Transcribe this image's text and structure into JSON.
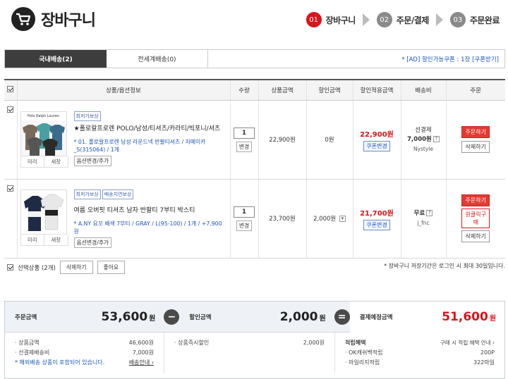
{
  "header": {
    "title": "장바구니"
  },
  "steps": [
    {
      "num": "01",
      "label": "장바구니",
      "active": true
    },
    {
      "num": "02",
      "label": "주문/결제",
      "active": false
    },
    {
      "num": "03",
      "label": "주문완료",
      "active": false
    }
  ],
  "tabs": [
    {
      "label": "국내배송(2)",
      "active": true
    },
    {
      "label": "전세계배송(0)",
      "active": false
    }
  ],
  "coupon_notice": "* [AD] 할인가능쿠폰 : 1장 [쿠폰받기]",
  "table": {
    "headers": [
      "상품/옵션정보",
      "수량",
      "상품금액",
      "할인금액",
      "할인적용금액",
      "배송비",
      "주문"
    ],
    "rows": [
      {
        "badges": [
          "최저가보상"
        ],
        "name": "★폴로랄프로렌 POLO/남성/티셔츠/카라티/빅포니/셔츠",
        "option": "* 01. 폴로랄프로렌 남성 라운드넥 반팔티셔츠 / 자메이카_S(315064) / 1개",
        "option_btn": "옵션변경/추가",
        "thumb_labels": [
          "미리",
          "새창"
        ],
        "qty": "1",
        "qty_btn": "변경",
        "price": "22,900원",
        "discount": "0원",
        "final_price": "22,900원",
        "coupon_btn": "쿠폰변경",
        "ship_type": "선결제",
        "ship_fee": "7,000원",
        "seller": "Nystyle",
        "order_btn": "주문하기",
        "delete_btn": "삭제하기",
        "extra_btn": ""
      },
      {
        "badges": [
          "최저가보상",
          "배송지연보상"
        ],
        "name": "여름 오버핏 티셔츠 남자 반팔티 7부티 박스티",
        "option": "* A.NY 요꼬 배색 7부티 / GRAY / L(95-100) / 1개 / +7,900원",
        "option_btn": "옵션변경/추가",
        "thumb_labels": [
          "미리",
          "새창"
        ],
        "qty": "1",
        "qty_btn": "변경",
        "price": "23,700원",
        "discount": "2,000원",
        "final_price": "21,700원",
        "coupon_btn": "쿠폰변경",
        "ship_type": "무료",
        "ship_fee": "",
        "seller": "j_fnc",
        "order_btn": "주문하기",
        "delete_btn": "삭제하기",
        "extra_btn": "원클릭구매"
      }
    ]
  },
  "bulk": {
    "selected": "선택상품 (2개)",
    "delete": "삭제하기",
    "like": "좋아요"
  },
  "storage_note": "* 장바구니 저장기간은 로그인 시 최대 30일입니다.",
  "summary": {
    "order_label": "주문금액",
    "order_value": "53,600",
    "unit": "원",
    "discount_label": "할인금액",
    "discount_value": "2,000",
    "pay_label": "결제예정금액",
    "pay_value": "51,600",
    "minus": "−",
    "equals": "=",
    "lines": {
      "goods_label": "· 상품금액",
      "goods_value": "46,600원",
      "ship_label": "· 선결제배송비",
      "ship_value": "7,000원",
      "overseas_note": "* 해외배송 상품이 포함되어 있습니다.",
      "ship_guide": "배송안내 ›",
      "instant_label": "· 상품즉시할인",
      "instant_value": "2,000원",
      "reward_title": "적립혜택",
      "reward_guide": "구매 시 적립 혜택 안내 ›",
      "ok_label": "· OK캐쉬백적립",
      "ok_value": "200P",
      "mile_label": "· 마일리지적립",
      "mile_value": "322마일"
    }
  },
  "colors": {
    "accent": "#d7151a",
    "link": "#1a55b8",
    "dark_tab": "#3d3d3d"
  }
}
